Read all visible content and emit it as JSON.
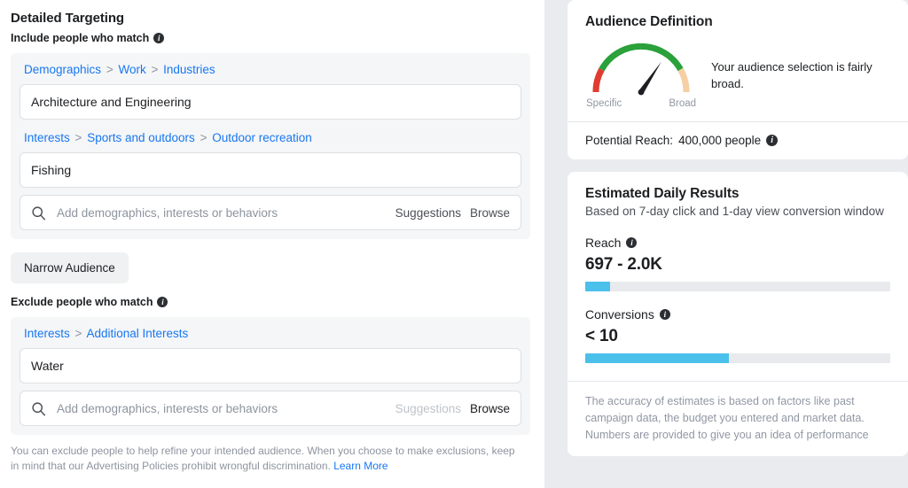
{
  "left": {
    "title": "Detailed Targeting",
    "include_label": "Include people who match",
    "include_groups": [
      {
        "breadcrumb": [
          "Demographics",
          "Work",
          "Industries"
        ],
        "separator": ">",
        "chip": "Architecture and Engineering"
      },
      {
        "breadcrumb": [
          "Interests",
          "Sports and outdoors",
          "Outdoor recreation"
        ],
        "separator": ">",
        "chip": "Fishing"
      }
    ],
    "include_search": {
      "placeholder": "Add demographics, interests or behaviors",
      "icon": "search-icon",
      "suggestions_label": "Suggestions",
      "browse_label": "Browse"
    },
    "narrow_button": "Narrow Audience",
    "exclude_label": "Exclude people who match",
    "exclude_groups": [
      {
        "breadcrumb": [
          "Interests",
          "Additional Interests"
        ],
        "separator": ">",
        "chip": "Water"
      }
    ],
    "exclude_search": {
      "placeholder": "Add demographics, interests or behaviors",
      "icon": "search-icon",
      "suggestions_label": "Suggestions",
      "browse_label": "Browse"
    },
    "disclaimer": "You can exclude people to help refine your intended audience. When you choose to make exclusions, keep in mind that our Advertising Policies prohibit wrongful discrimination.",
    "disclaimer_link": "Learn More",
    "info_icon": "info-icon"
  },
  "audience": {
    "title": "Audience Definition",
    "gauge": {
      "left_label": "Specific",
      "right_label": "Broad",
      "needle_angle_deg": 55,
      "segments": [
        {
          "name": "specific",
          "color": "#e03c31",
          "start_deg": 180,
          "end_deg": 160
        },
        {
          "name": "moderate",
          "color": "#2aa13a",
          "start_deg": 160,
          "end_deg": 20
        },
        {
          "name": "broad",
          "color": "#f7cfa3",
          "start_deg": 20,
          "end_deg": 0
        }
      ]
    },
    "note": "Your audience selection is fairly broad.",
    "potential_reach_label": "Potential Reach:",
    "potential_reach_value": "400,000 people",
    "info_icon": "info-icon"
  },
  "estimates": {
    "title": "Estimated Daily Results",
    "subtitle": "Based on 7-day click and 1-day view conversion window",
    "metrics": [
      {
        "label": "Reach",
        "value": "697 - 2.0K",
        "fill_percent": 8,
        "color": "#4bc0ea"
      },
      {
        "label": "Conversions",
        "value": "< 10",
        "fill_percent": 47,
        "color": "#4bc0ea"
      }
    ],
    "accuracy_note": "The accuracy of estimates is based on factors like past campaign data, the budget you entered and market data. Numbers are provided to give you an idea of performance",
    "info_icon": "info-icon"
  }
}
